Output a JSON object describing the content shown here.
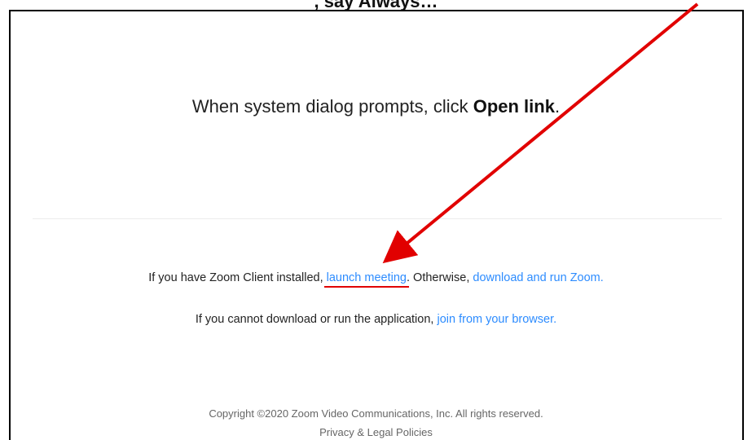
{
  "top_text": ", say Always…",
  "prompt": {
    "prefix": "When system dialog prompts, click ",
    "bold": "Open link",
    "suffix": "."
  },
  "launch_line": {
    "prefix": "If you have Zoom Client installed, ",
    "launch_link": "launch meeting",
    "middle": ". Otherwise, ",
    "download_link": "download and run Zoom."
  },
  "browser_line": {
    "prefix": "If you cannot download or run the application, ",
    "join_link": "join from your browser."
  },
  "footer": {
    "copyright": "Copyright ©2020 Zoom Video Communications, Inc. All rights reserved.",
    "privacy_link": "Privacy & Legal Policies"
  },
  "colors": {
    "link": "#2d8cff",
    "annotation": "#e10000"
  }
}
